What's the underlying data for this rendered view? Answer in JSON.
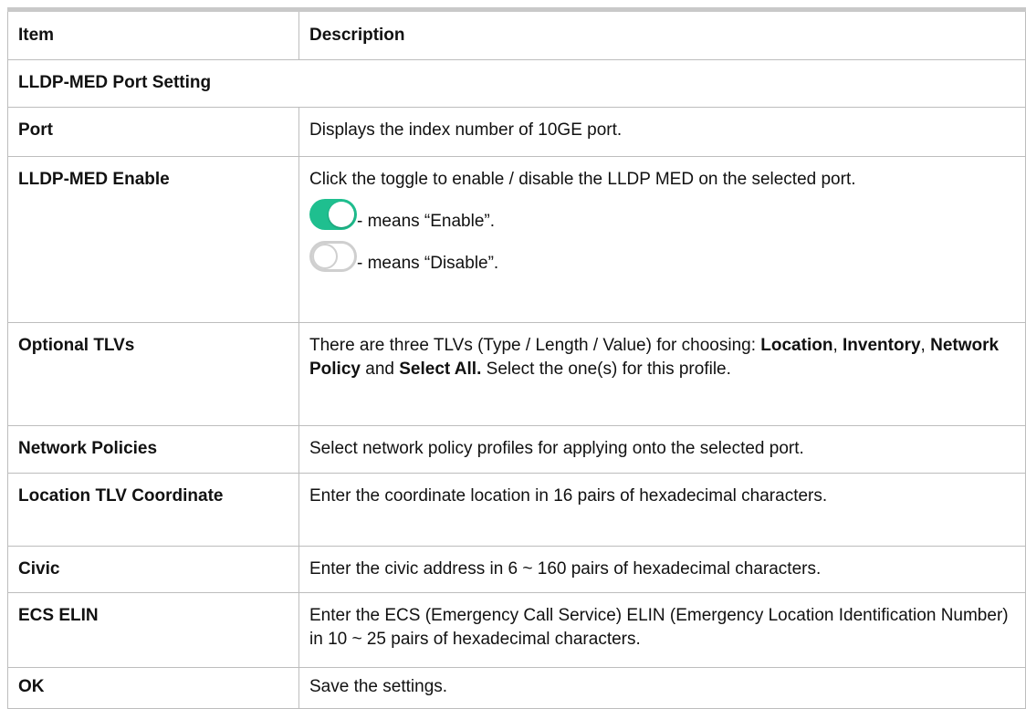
{
  "table": {
    "header": {
      "item": "Item",
      "description": "Description"
    },
    "section_title": "LLDP-MED Port Setting",
    "rows": [
      {
        "item": "Port",
        "description": "Displays the index number of 10GE port."
      },
      {
        "item": "LLDP-MED Enable",
        "description": "Click the toggle to enable / disable the LLDP MED on the selected port.",
        "toggle_on_text": " - means “Enable”.",
        "toggle_off_text": " - means “Disable”.",
        "toggle_on_color": "#1fbf8f",
        "toggle_off_color": "#cfcfcf"
      },
      {
        "item": "Optional TLVs",
        "description_parts": {
          "p1": "There are three TLVs (Type / Length / Value) for choosing: ",
          "b1": "Location",
          "p2": ", ",
          "b2": "Inventory",
          "p3": ", ",
          "b3": "Network Policy",
          "p4": " and ",
          "b4": "Select All.",
          "p5": " Select the one(s) for this profile."
        }
      },
      {
        "item": "Network Policies",
        "description": "Select network policy profiles for applying onto the selected port."
      },
      {
        "item": "Location TLV Coordinate",
        "description": "Enter the coordinate location in 16 pairs of hexadecimal characters."
      },
      {
        "item": "Civic",
        "description": "Enter the civic address in 6 ~ 160 pairs of hexadecimal characters."
      },
      {
        "item": "ECS ELIN",
        "description": "Enter the ECS (Emergency Call Service) ELIN (Emergency Location Identification Number) in 10 ~ 25 pairs of hexadecimal characters."
      },
      {
        "item": "OK",
        "description": "Save the settings."
      }
    ]
  }
}
